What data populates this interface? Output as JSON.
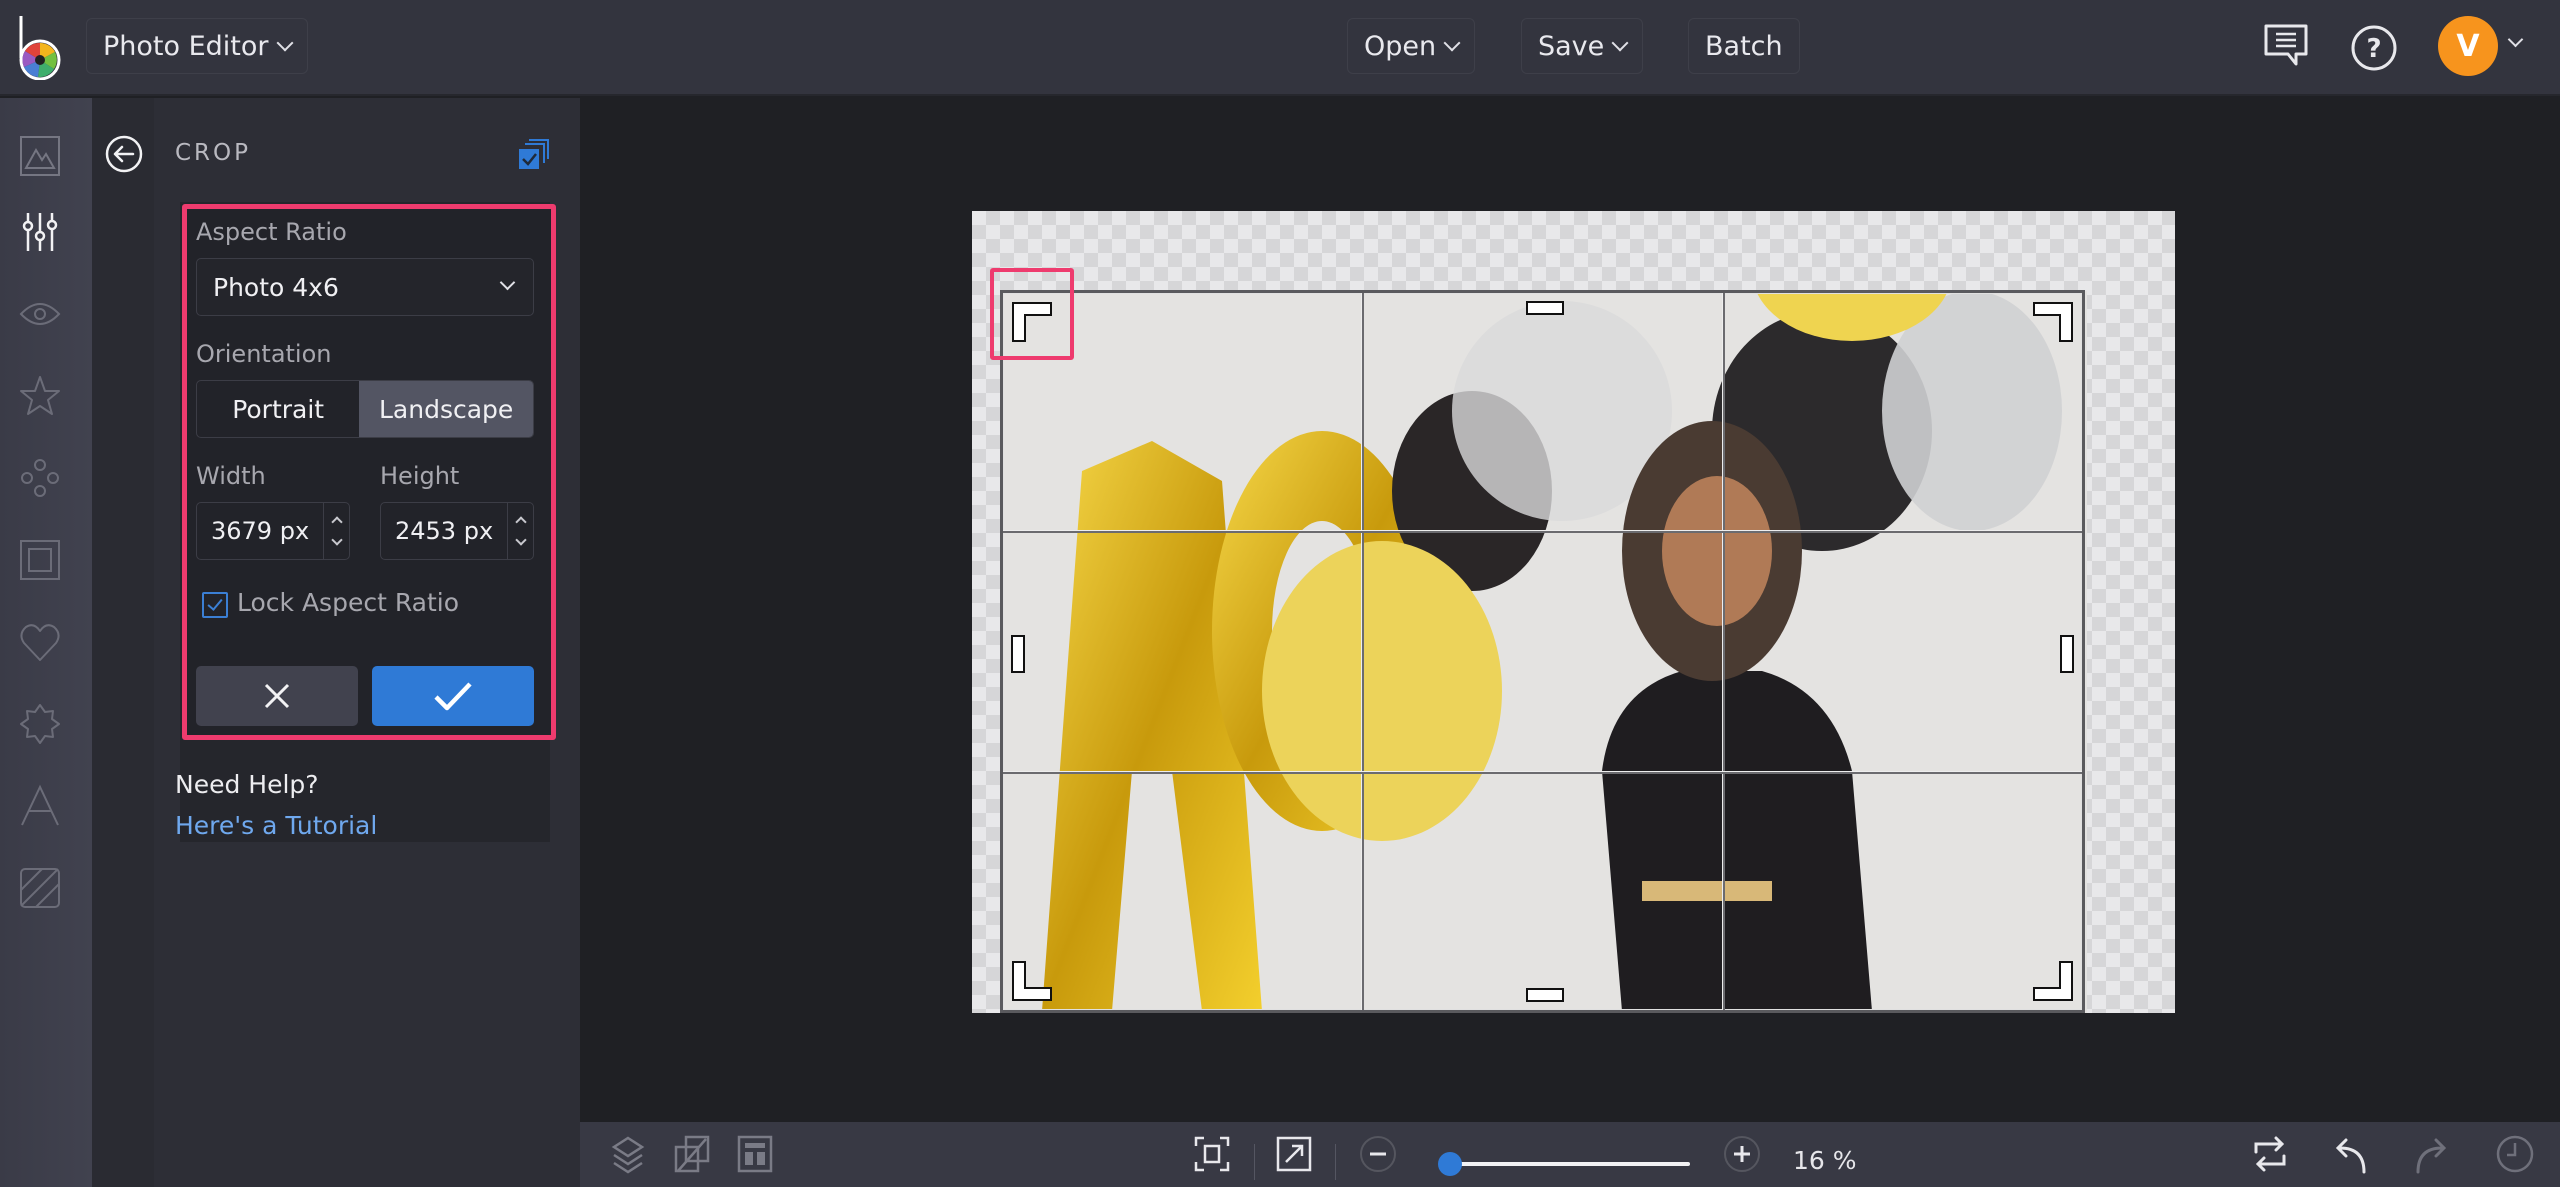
{
  "topbar": {
    "mode_label": "Photo Editor",
    "open_label": "Open",
    "save_label": "Save",
    "batch_label": "Batch",
    "avatar_initial": "V",
    "avatar_color": "#f7941d",
    "icons": [
      "comment-icon",
      "help-icon",
      "avatar",
      "chevron-down-icon"
    ]
  },
  "sidebar": {
    "items": [
      {
        "name": "image-icon",
        "active": false
      },
      {
        "name": "adjustments-icon",
        "active": true
      },
      {
        "name": "eye-icon",
        "active": false
      },
      {
        "name": "star-icon",
        "active": false
      },
      {
        "name": "graphics-icon",
        "active": false
      },
      {
        "name": "frame-icon",
        "active": false
      },
      {
        "name": "heart-icon",
        "active": false
      },
      {
        "name": "badge-icon",
        "active": false
      },
      {
        "name": "text-icon",
        "active": false
      },
      {
        "name": "texture-icon",
        "active": false
      }
    ]
  },
  "panel": {
    "title": "CROP",
    "aspect_ratio_label": "Aspect Ratio",
    "aspect_ratio_value": "Photo 4x6",
    "orientation_label": "Orientation",
    "orientation_options": [
      "Portrait",
      "Landscape"
    ],
    "orientation_selected": "Landscape",
    "width_label": "Width",
    "width_value": "3679 px",
    "height_label": "Height",
    "height_value": "2453 px",
    "lock_label": "Lock Aspect Ratio",
    "lock_checked": true,
    "help_title": "Need Help?",
    "help_link": "Here's a Tutorial"
  },
  "bottombar": {
    "zoom_percent": "16 %",
    "zoom_slider_fraction": 0.04,
    "icons": [
      "layers-icon",
      "compare-icon",
      "layout-icon",
      "fit-screen-icon",
      "actual-size-icon",
      "zoom-out-icon",
      "zoom-in-icon",
      "flip-icon",
      "undo-icon",
      "redo-icon",
      "history-icon"
    ]
  },
  "colors": {
    "accent": "#2f7ad6",
    "highlight": "#ee3b6e",
    "link": "#6fa8ee"
  }
}
